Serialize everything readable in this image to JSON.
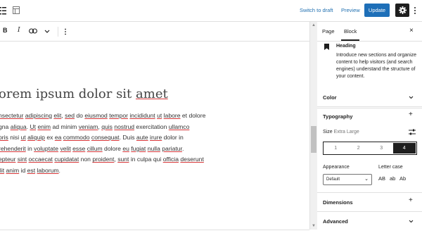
{
  "topbar": {
    "switch_to_draft": "Switch to draft",
    "preview": "Preview",
    "update": "Update"
  },
  "toolbar": {
    "bold": "B",
    "italic": "I",
    "more": "⌄",
    "options": "⋮"
  },
  "editor": {
    "heading_plain": "orem ipsum dolor sit ",
    "heading_underlined": "amet",
    "paragraph_lines": [
      [
        [
          "s",
          "nsectetur"
        ],
        [
          "t",
          " "
        ],
        [
          "s",
          "adipiscing"
        ],
        [
          "t",
          " "
        ],
        [
          "s",
          "elit"
        ],
        [
          "t",
          ", "
        ],
        [
          "s",
          "sed"
        ],
        [
          "t",
          " do "
        ],
        [
          "s",
          "eiusmod"
        ],
        [
          "t",
          " "
        ],
        [
          "s",
          "tempor"
        ],
        [
          "t",
          " "
        ],
        [
          "s",
          "incididunt"
        ],
        [
          "t",
          " "
        ],
        [
          "s",
          "ut"
        ],
        [
          "t",
          " "
        ],
        [
          "s",
          "labore"
        ],
        [
          "t",
          " et dolore"
        ]
      ],
      [
        [
          "t",
          "gna "
        ],
        [
          "s",
          "aliqua"
        ],
        [
          "t",
          ". "
        ],
        [
          "s",
          "Ut"
        ],
        [
          "t",
          " "
        ],
        [
          "s",
          "enim"
        ],
        [
          "t",
          " ad minim "
        ],
        [
          "s",
          "veniam"
        ],
        [
          "t",
          ", "
        ],
        [
          "s",
          "quis"
        ],
        [
          "t",
          " "
        ],
        [
          "s",
          "nostrud"
        ],
        [
          "t",
          " exercitation "
        ],
        [
          "s",
          "ullamco"
        ]
      ],
      [
        [
          "s",
          "oris"
        ],
        [
          "t",
          " nisi "
        ],
        [
          "s",
          "ut"
        ],
        [
          "t",
          " "
        ],
        [
          "s",
          "aliquip"
        ],
        [
          "t",
          " ex "
        ],
        [
          "s",
          "ea"
        ],
        [
          "t",
          " "
        ],
        [
          "s",
          "commodo"
        ],
        [
          "t",
          " "
        ],
        [
          "s",
          "consequat"
        ],
        [
          "t",
          ".  Duis "
        ],
        [
          "s",
          "aute"
        ],
        [
          "t",
          " "
        ],
        [
          "s",
          "irure"
        ],
        [
          "t",
          " dolor in"
        ]
      ],
      [
        [
          "s",
          "rehenderit"
        ],
        [
          "t",
          " in "
        ],
        [
          "s",
          "voluptate"
        ],
        [
          "t",
          " "
        ],
        [
          "s",
          "velit"
        ],
        [
          "t",
          " "
        ],
        [
          "s",
          "esse"
        ],
        [
          "t",
          " "
        ],
        [
          "s",
          "cillum"
        ],
        [
          "t",
          " dolore "
        ],
        [
          "s",
          "eu"
        ],
        [
          "t",
          " "
        ],
        [
          "s",
          "fugiat"
        ],
        [
          "t",
          " "
        ],
        [
          "s",
          "nulla"
        ],
        [
          "t",
          " "
        ],
        [
          "s",
          "pariatur"
        ],
        [
          "t",
          "."
        ]
      ],
      [
        [
          "s",
          "epteur"
        ],
        [
          "t",
          " "
        ],
        [
          "s",
          "sint"
        ],
        [
          "t",
          " "
        ],
        [
          "s",
          "occaecat"
        ],
        [
          "t",
          " "
        ],
        [
          "s",
          "cupidatat"
        ],
        [
          "t",
          " non "
        ],
        [
          "s",
          "proident"
        ],
        [
          "t",
          ", "
        ],
        [
          "s",
          "sunt"
        ],
        [
          "t",
          " in culpa qui "
        ],
        [
          "s",
          "officia"
        ],
        [
          "t",
          " "
        ],
        [
          "s",
          "deserunt"
        ]
      ],
      [
        [
          "s",
          "llit"
        ],
        [
          "t",
          " "
        ],
        [
          "s",
          "anim"
        ],
        [
          "t",
          " id "
        ],
        [
          "s",
          "est"
        ],
        [
          "t",
          " "
        ],
        [
          "s",
          "laborum"
        ],
        [
          "t",
          "."
        ]
      ]
    ]
  },
  "sidebar": {
    "tab_page": "Page",
    "tab_block": "Block",
    "close": "×",
    "block_title": "Heading",
    "block_desc": "Introduce new sections and organize content to help visitors (and search engines) understand the structure of your content.",
    "color_label": "Color",
    "typography_label": "Typography",
    "size_label": "Size",
    "size_value": "Extra Large",
    "size_options": [
      "1",
      "2",
      "3",
      "4"
    ],
    "size_selected_index": 3,
    "appearance_label": "Appearance",
    "appearance_value": "Default",
    "lettercase_label": "Letter case",
    "lettercase_options": [
      "AB",
      "ab",
      "Ab"
    ],
    "dimensions_label": "Dimensions",
    "advanced_label": "Advanced"
  },
  "colors": {
    "accent": "#1e6fb8",
    "link": "#2271b1",
    "spellcheck": "#d63638"
  }
}
